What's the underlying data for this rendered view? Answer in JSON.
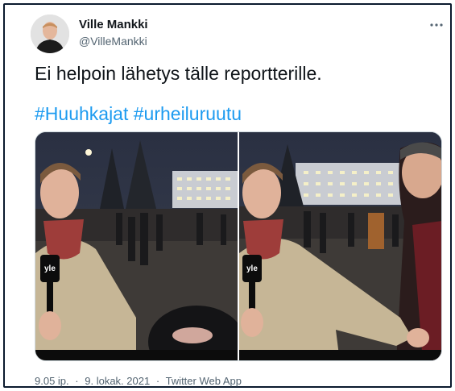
{
  "author": {
    "display_name": "Ville Mankki",
    "handle": "@VilleMankki"
  },
  "tweet": {
    "text": "Ei helpoin lähetys tälle reportterille.",
    "hashtags": [
      "#Huuhkajat",
      "#urheiluruutu"
    ]
  },
  "media": {
    "images": [
      {
        "alt": "left-frame",
        "logo_text": "yle"
      },
      {
        "alt": "right-frame",
        "logo_text": "yle"
      }
    ]
  },
  "meta": {
    "time": "9.05 ip.",
    "sep1": "·",
    "date": "9. lokak. 2021",
    "sep2": "·",
    "client": "Twitter Web App"
  },
  "icons": {
    "more": "more-dots-icon"
  },
  "colors": {
    "link": "#1d9bf0",
    "secondary_text": "#536471",
    "frame_border": "#0b1a2e"
  }
}
